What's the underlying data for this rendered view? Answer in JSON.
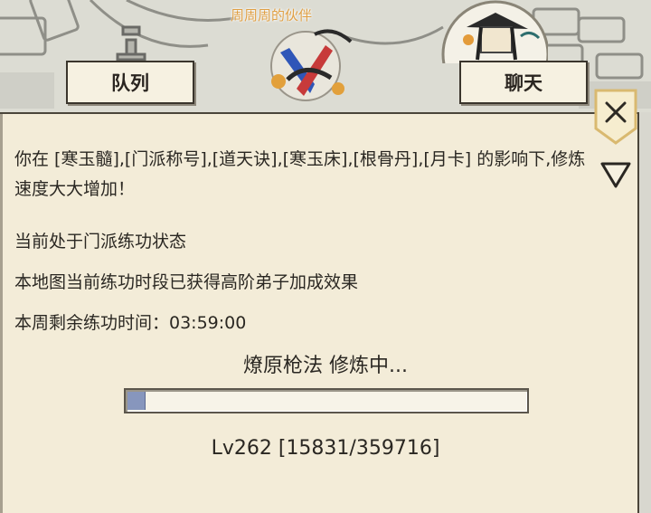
{
  "header": {
    "party_name": "周周周的伙伴"
  },
  "tabs": {
    "team_label": "队列",
    "chat_label": "聊天"
  },
  "training_panel": {
    "buff_message": "你在 [寒玉髓],[门派称号],[道天诀],[寒玉床],[根骨丹],[月卡] 的影响下,修炼速度大大增加！",
    "status_lines": [
      "当前处于门派练功状态",
      "本地图当前练功时段已获得高阶弟子加成效果",
      "本周剩余练功时间：03:59:00"
    ],
    "training_title": "燎原枪法 修炼中...",
    "progress_fraction": 0.044,
    "level_text": "Lv262  [15831/359716]"
  },
  "icons": {
    "close": "close-x-icon",
    "collapse": "triangle-down-icon"
  },
  "colors": {
    "panel_bg": "#f3ecd8",
    "progress_fill": "#8796bd",
    "party_name": "#e0a045"
  }
}
